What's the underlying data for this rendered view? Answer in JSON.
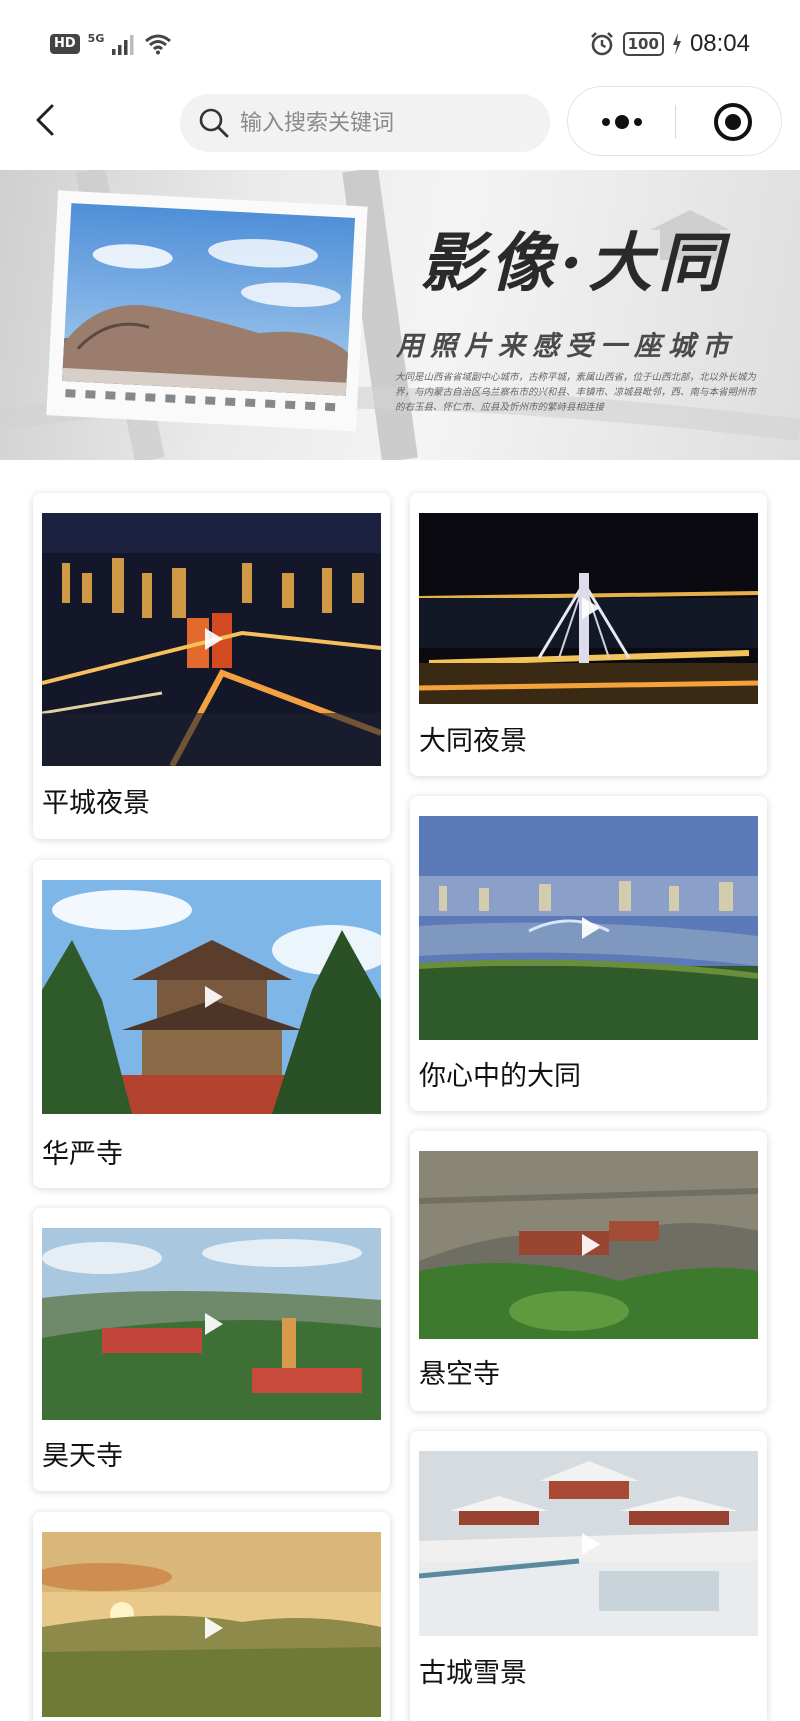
{
  "status_bar": {
    "hd": "HD",
    "network": "5G",
    "battery": "100",
    "time": "08:04",
    "icons": [
      "signal-icon",
      "wifi-icon",
      "alarm-icon",
      "battery-icon",
      "charging-icon"
    ]
  },
  "nav": {
    "back_icon": "back-arrow-icon",
    "search_placeholder": "输入搜索关键词",
    "more_icon": "more-dots-icon",
    "close_icon": "target-close-icon"
  },
  "banner": {
    "title": "影像·大同",
    "subtitle": "用照片来感受一座城市",
    "description": "大同是山西省省域副中心城市，古称平城，素属山西省，位于山西北部，北以外长城为界，与内蒙古自治区乌兰察布市的兴和县、丰镇市、凉城县毗邻，西、南与本省朔州市的右玉县、怀仁市、应县及忻州市的繁峙县相连接"
  },
  "videos": {
    "left": [
      {
        "title": "平城夜景"
      },
      {
        "title": "华严寺"
      },
      {
        "title": "昊天寺"
      },
      {
        "title": ""
      }
    ],
    "right": [
      {
        "title": "大同夜景"
      },
      {
        "title": "你心中的大同"
      },
      {
        "title": "悬空寺"
      },
      {
        "title": "古城雪景"
      }
    ]
  },
  "colors": {
    "background": "#ffffff",
    "search_bg": "#f2f2f2",
    "text": "#111111"
  }
}
